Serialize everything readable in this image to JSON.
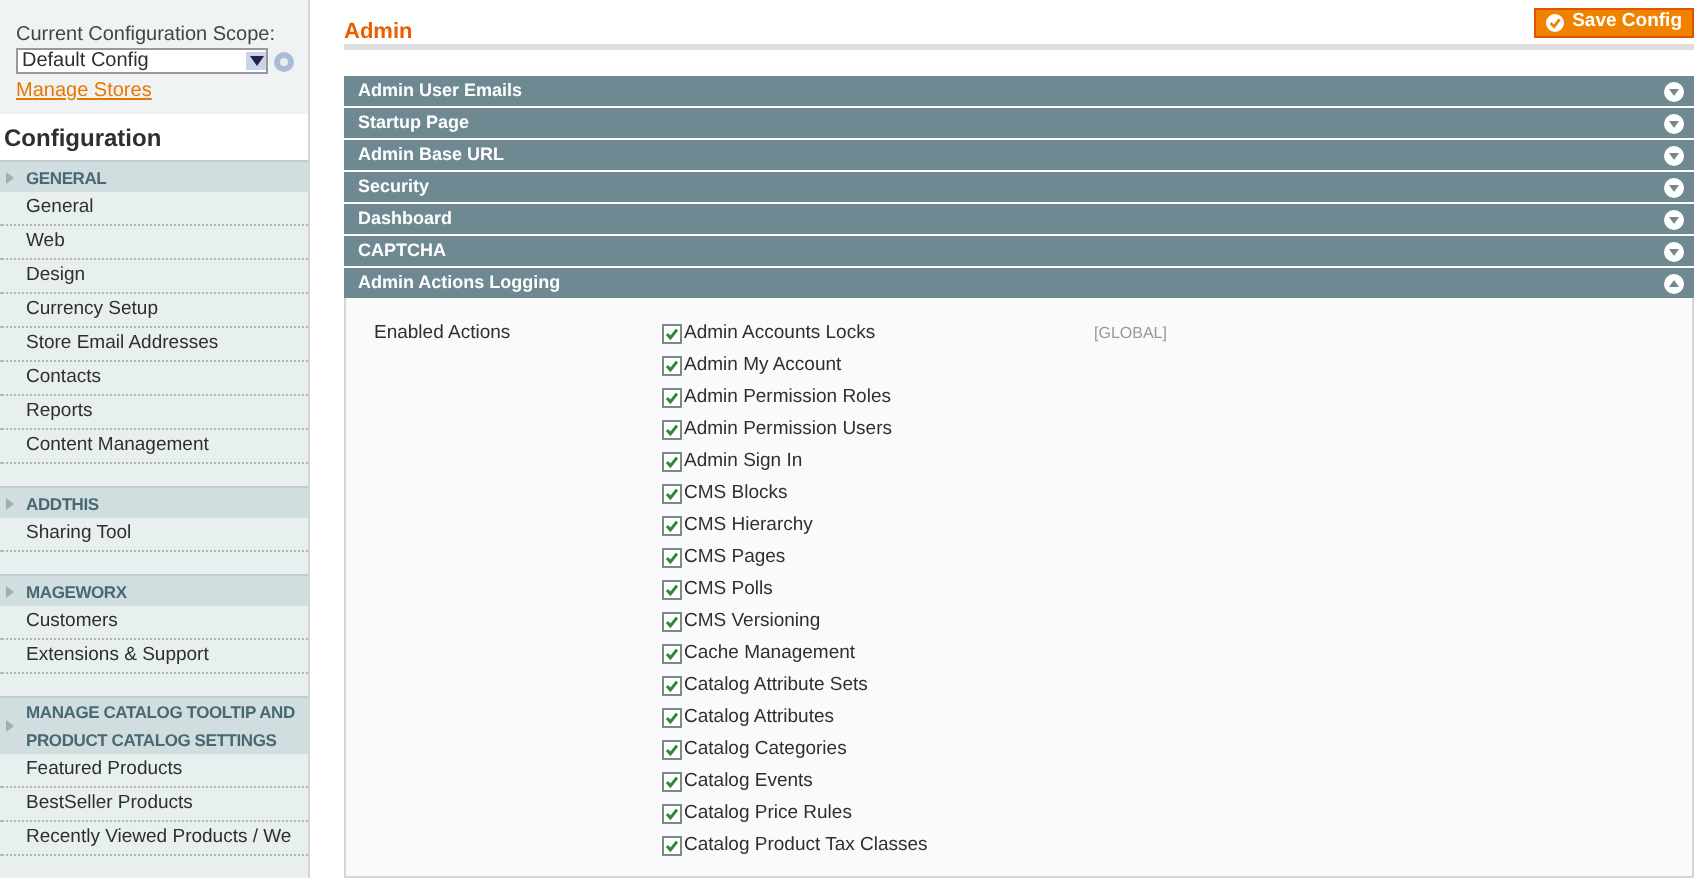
{
  "scope": {
    "label": "Current Configuration Scope:",
    "value": "Default Config",
    "link": "Manage Stores"
  },
  "sidebar": {
    "title": "Configuration",
    "groups": [
      {
        "title": "GENERAL",
        "items": [
          "General",
          "Web",
          "Design",
          "Currency Setup",
          "Store Email Addresses",
          "Contacts",
          "Reports",
          "Content Management"
        ]
      },
      {
        "title": "ADDTHIS",
        "items": [
          "Sharing Tool"
        ]
      },
      {
        "title": "MAGEWORX",
        "items": [
          "Customers",
          "Extensions & Support"
        ]
      },
      {
        "title": "MANAGE CATALOG TOOLTIP AND PRODUCT CATALOG SETTINGS",
        "items": [
          "Featured Products",
          "BestSeller Products",
          "Recently Viewed Products / We"
        ]
      }
    ]
  },
  "page": {
    "title": "Admin",
    "save_button": "Save Config"
  },
  "sections": [
    {
      "title": "Admin User Emails",
      "expanded": false
    },
    {
      "title": "Startup Page",
      "expanded": false
    },
    {
      "title": "Admin Base URL",
      "expanded": false
    },
    {
      "title": "Security",
      "expanded": false
    },
    {
      "title": "Dashboard",
      "expanded": false
    },
    {
      "title": "CAPTCHA",
      "expanded": false
    },
    {
      "title": "Admin Actions Logging",
      "expanded": true
    }
  ],
  "field": {
    "label": "Enabled Actions",
    "scope": "[GLOBAL]",
    "options": [
      {
        "label": "Admin Accounts Locks",
        "checked": true
      },
      {
        "label": "Admin My Account",
        "checked": true
      },
      {
        "label": "Admin Permission Roles",
        "checked": true
      },
      {
        "label": "Admin Permission Users",
        "checked": true
      },
      {
        "label": "Admin Sign In",
        "checked": true
      },
      {
        "label": "CMS Blocks",
        "checked": true
      },
      {
        "label": "CMS Hierarchy",
        "checked": true
      },
      {
        "label": "CMS Pages",
        "checked": true
      },
      {
        "label": "CMS Polls",
        "checked": true
      },
      {
        "label": "CMS Versioning",
        "checked": true
      },
      {
        "label": "Cache Management",
        "checked": true
      },
      {
        "label": "Catalog Attribute Sets",
        "checked": true
      },
      {
        "label": "Catalog Attributes",
        "checked": true
      },
      {
        "label": "Catalog Categories",
        "checked": true
      },
      {
        "label": "Catalog Events",
        "checked": true
      },
      {
        "label": "Catalog Price Rules",
        "checked": true
      },
      {
        "label": "Catalog Product Tax Classes",
        "checked": true
      }
    ]
  }
}
